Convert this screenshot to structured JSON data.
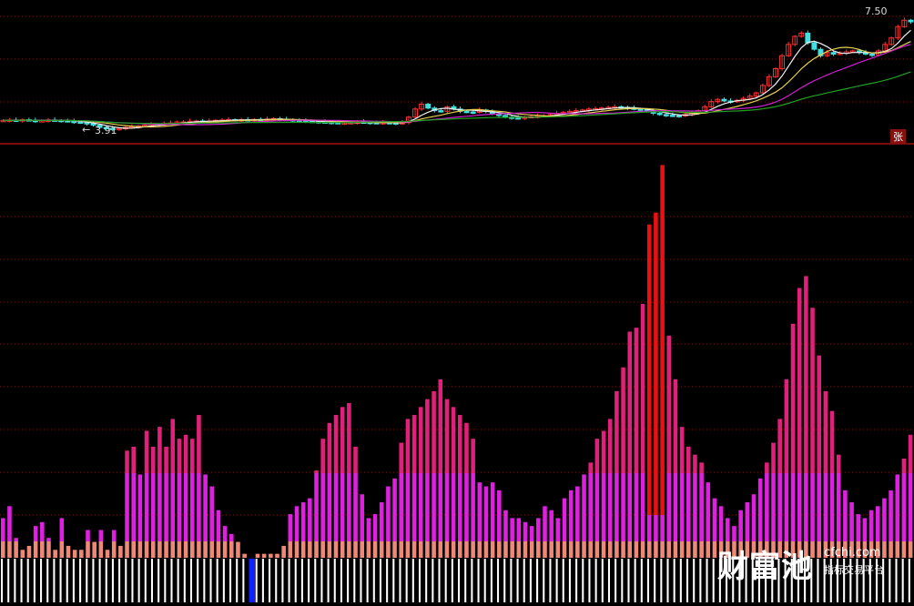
{
  "colors": {
    "background": "#000000",
    "grid": "#7a1010",
    "divider": "#a01010",
    "candle_up": "#ff3030",
    "candle_down": "#40e0e0",
    "ma_white": "#f0f0f0",
    "ma_yellow": "#e6d050",
    "ma_magenta": "#d020d0",
    "ma_green": "#20a020",
    "bar_salmon": "#f08878",
    "bar_magenta": "#e020e0",
    "bar_pink": "#e0207a",
    "bar_red": "#ee1010",
    "bar_blue": "#1020ff",
    "bar_white": "#ffffff"
  },
  "labels": {
    "price_high": "7.50",
    "price_low": "3.91",
    "side_tag": "张",
    "watermark_cn": "财富池",
    "watermark_url": "cfchi.com",
    "watermark_sub": "指标交易平台"
  },
  "chart_data": [
    {
      "type": "candlestick",
      "title": "",
      "annotations": [
        "7.50",
        "3.91"
      ],
      "ylim": [
        3.7,
        7.7
      ],
      "close": [
        4.2,
        4.21,
        4.19,
        4.22,
        4.2,
        4.18,
        4.19,
        4.21,
        4.2,
        4.19,
        4.17,
        4.15,
        4.13,
        4.1,
        4.05,
        3.98,
        3.95,
        3.92,
        3.95,
        3.98,
        4.0,
        4.02,
        4.05,
        4.07,
        4.08,
        4.1,
        4.12,
        4.15,
        4.15,
        4.17,
        4.18,
        4.17,
        4.18,
        4.2,
        4.21,
        4.22,
        4.21,
        4.22,
        4.21,
        4.23,
        4.22,
        4.24,
        4.25,
        4.23,
        4.22,
        4.2,
        4.18,
        4.17,
        4.16,
        4.15,
        4.14,
        4.13,
        4.12,
        4.12,
        4.13,
        4.15,
        4.14,
        4.13,
        4.12,
        4.13,
        4.12,
        4.11,
        4.13,
        4.3,
        4.55,
        4.7,
        4.58,
        4.5,
        4.48,
        4.62,
        4.55,
        4.48,
        4.46,
        4.45,
        4.52,
        4.48,
        4.4,
        4.35,
        4.3,
        4.28,
        4.27,
        4.3,
        4.32,
        4.33,
        4.35,
        4.38,
        4.42,
        4.45,
        4.48,
        4.5,
        4.52,
        4.55,
        4.56,
        4.58,
        4.6,
        4.62,
        4.6,
        4.58,
        4.55,
        4.52,
        4.48,
        4.42,
        4.38,
        4.36,
        4.35,
        4.34,
        4.38,
        4.42,
        4.5,
        4.62,
        4.78,
        4.85,
        4.8,
        4.78,
        4.82,
        4.88,
        4.95,
        5.05,
        5.28,
        5.55,
        5.8,
        6.2,
        6.55,
        6.8,
        6.9,
        6.6,
        6.4,
        6.2,
        6.3,
        6.25,
        6.28,
        6.32,
        6.35,
        6.3,
        6.25,
        6.22,
        6.35,
        6.55,
        6.75,
        7.1,
        7.3,
        7.25
      ]
    },
    {
      "type": "bar",
      "title": "",
      "ylim": [
        0,
        100
      ],
      "values": [
        10,
        13,
        5,
        2,
        3,
        8,
        9,
        5,
        2,
        10,
        3,
        2,
        2,
        7,
        4,
        7,
        2,
        7,
        3,
        27,
        28,
        21,
        32,
        28,
        33,
        28,
        35,
        30,
        31,
        30,
        36,
        21,
        18,
        12,
        8,
        6,
        4,
        1,
        0,
        1,
        1,
        1,
        1,
        3,
        11,
        13,
        14,
        15,
        22,
        30,
        34,
        36,
        38,
        39,
        28,
        16,
        10,
        11,
        14,
        18,
        20,
        29,
        35,
        36,
        38,
        40,
        42,
        45,
        40,
        38,
        36,
        34,
        30,
        19,
        18,
        19,
        17,
        12,
        10,
        10,
        9,
        8,
        10,
        13,
        12,
        10,
        15,
        17,
        18,
        21,
        24,
        30,
        32,
        35,
        42,
        48,
        57,
        58,
        64,
        84,
        87,
        99,
        56,
        45,
        33,
        28,
        26,
        24,
        19,
        15,
        13,
        10,
        8,
        12,
        14,
        16,
        20,
        24,
        29,
        35,
        45,
        59,
        68,
        71,
        63,
        51,
        42,
        37,
        26,
        17,
        14,
        11,
        10,
        12,
        13,
        15,
        17,
        21,
        25,
        31
      ]
    }
  ]
}
